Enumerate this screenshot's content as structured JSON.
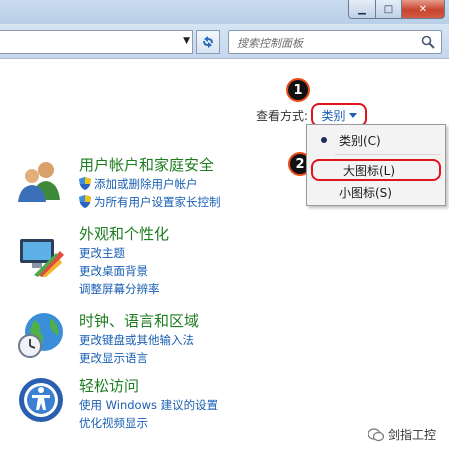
{
  "window": {
    "minimize_glyph": "▁",
    "maximize_glyph": "□",
    "close_glyph": "✕"
  },
  "search": {
    "placeholder": "搜索控制面板"
  },
  "view_by": {
    "label": "查看方式:",
    "value": "类别"
  },
  "dropdown": {
    "items": [
      "类别(C)",
      "大图标(L)",
      "小图标(S)"
    ],
    "selected": "类别(C)"
  },
  "annotations": {
    "step1": "1",
    "step2": "2",
    "color": "#e0141b"
  },
  "categories": [
    {
      "title": "用户帐户和家庭安全",
      "icon": "users-icon",
      "links": [
        "添加或删除用户帐户",
        "为所有用户设置家长控制"
      ]
    },
    {
      "title": "外观和个性化",
      "icon": "monitor-paint-icon",
      "links": [
        "更改主题",
        "更改桌面背景",
        "调整屏幕分辨率"
      ]
    },
    {
      "title": "时钟、语言和区域",
      "icon": "globe-clock-icon",
      "links": [
        "更改键盘或其他输入法",
        "更改显示语言"
      ]
    },
    {
      "title": "轻松访问",
      "icon": "ease-of-access-icon",
      "links": [
        "使用 Windows 建议的设置",
        "优化视频显示"
      ]
    }
  ],
  "watermark": {
    "text": "剑指工控"
  },
  "colors": {
    "category_title": "#1e7d20",
    "link": "#1a5fb4",
    "highlight": "#e0141b"
  }
}
